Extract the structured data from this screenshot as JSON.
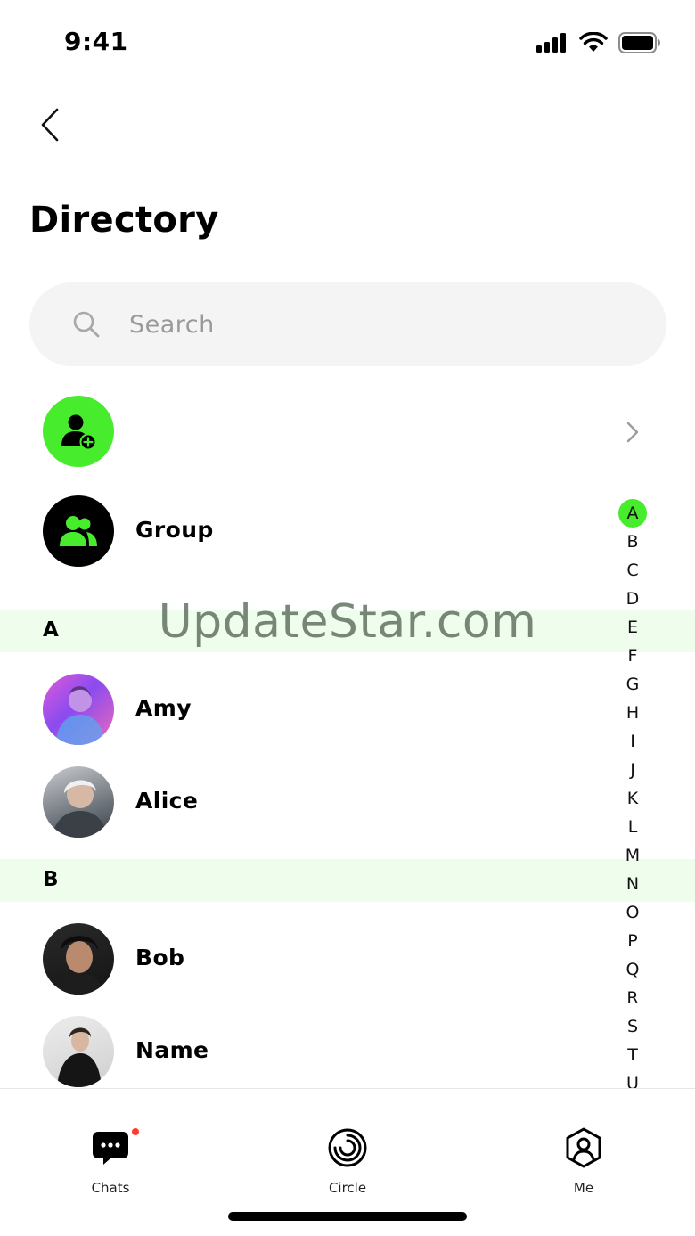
{
  "status_bar": {
    "time": "9:41"
  },
  "header": {
    "title": "Directory"
  },
  "search": {
    "placeholder": "Search"
  },
  "rows": {
    "add_contact": {
      "label": ""
    },
    "group": {
      "label": "Group"
    }
  },
  "sections": [
    {
      "letter": "A",
      "contacts": [
        {
          "name": "Amy"
        },
        {
          "name": "Alice"
        }
      ]
    },
    {
      "letter": "B",
      "contacts": [
        {
          "name": "Bob"
        },
        {
          "name": "Name"
        }
      ]
    }
  ],
  "alphabet_index": {
    "letters": [
      "A",
      "B",
      "C",
      "D",
      "E",
      "F",
      "G",
      "H",
      "I",
      "J",
      "K",
      "L",
      "M",
      "N",
      "O",
      "P",
      "Q",
      "R",
      "S",
      "T",
      "U"
    ],
    "active": "A"
  },
  "watermark": "UpdateStar.com",
  "tabs": [
    {
      "label": "Chats",
      "icon": "chat-bubble-icon",
      "badge": true
    },
    {
      "label": "Circle",
      "icon": "circle-ring-icon",
      "badge": false
    },
    {
      "label": "Me",
      "icon": "profile-hexagon-icon",
      "badge": false
    }
  ],
  "colors": {
    "accent": "#47ec2c",
    "section_bg": "#effded",
    "search_bg": "#f4f4f4",
    "badge": "#ff3b30"
  }
}
